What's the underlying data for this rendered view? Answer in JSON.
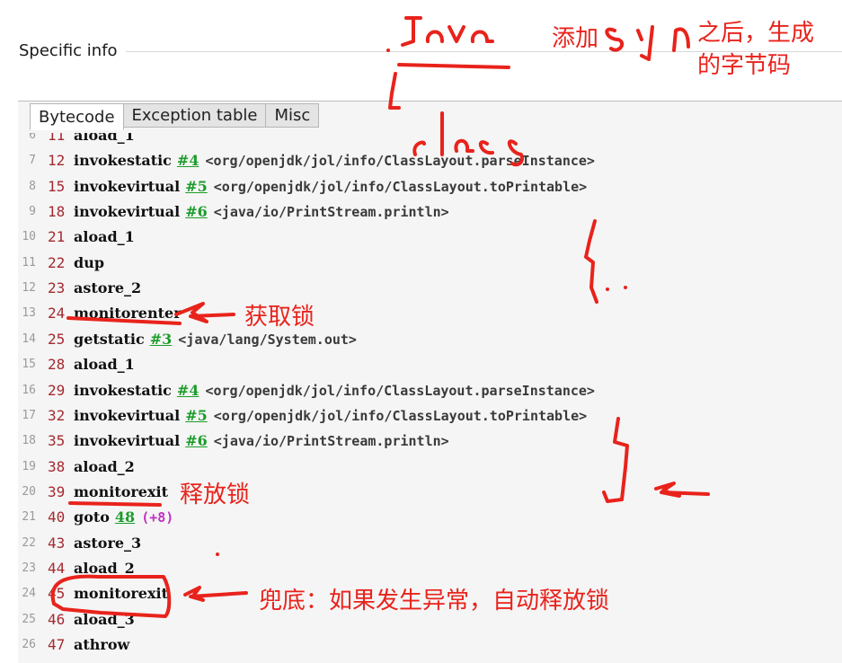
{
  "header": {
    "title": "Specific info"
  },
  "tabs": [
    {
      "label": "Bytecode",
      "active": true
    },
    {
      "label": "Exception table",
      "active": false
    },
    {
      "label": "Misc",
      "active": false
    }
  ],
  "bytecode": [
    {
      "line": "6",
      "offset": "11",
      "op": "aload_1"
    },
    {
      "line": "7",
      "offset": "12",
      "op": "invokestatic",
      "ref": "#4",
      "comment": "<org/openjdk/jol/info/ClassLayout.parseInstance>"
    },
    {
      "line": "8",
      "offset": "15",
      "op": "invokevirtual",
      "ref": "#5",
      "comment": "<org/openjdk/jol/info/ClassLayout.toPrintable>"
    },
    {
      "line": "9",
      "offset": "18",
      "op": "invokevirtual",
      "ref": "#6",
      "comment": "<java/io/PrintStream.println>"
    },
    {
      "line": "10",
      "offset": "21",
      "op": "aload_1"
    },
    {
      "line": "11",
      "offset": "22",
      "op": "dup"
    },
    {
      "line": "12",
      "offset": "23",
      "op": "astore_2"
    },
    {
      "line": "13",
      "offset": "24",
      "op": "monitorenter"
    },
    {
      "line": "14",
      "offset": "25",
      "op": "getstatic",
      "ref": "#3",
      "comment": "<java/lang/System.out>"
    },
    {
      "line": "15",
      "offset": "28",
      "op": "aload_1"
    },
    {
      "line": "16",
      "offset": "29",
      "op": "invokestatic",
      "ref": "#4",
      "comment": "<org/openjdk/jol/info/ClassLayout.parseInstance>"
    },
    {
      "line": "17",
      "offset": "32",
      "op": "invokevirtual",
      "ref": "#5",
      "comment": "<org/openjdk/jol/info/ClassLayout.toPrintable>"
    },
    {
      "line": "18",
      "offset": "35",
      "op": "invokevirtual",
      "ref": "#6",
      "comment": "<java/io/PrintStream.println>"
    },
    {
      "line": "19",
      "offset": "38",
      "op": "aload_2"
    },
    {
      "line": "20",
      "offset": "39",
      "op": "monitorexit"
    },
    {
      "line": "21",
      "offset": "40",
      "op": "goto",
      "ref": "48",
      "jump": "(+8)"
    },
    {
      "line": "22",
      "offset": "43",
      "op": "astore_3"
    },
    {
      "line": "23",
      "offset": "44",
      "op": "aload_2"
    },
    {
      "line": "24",
      "offset": "45",
      "op": "monitorexit"
    },
    {
      "line": "25",
      "offset": "46",
      "op": "aload_3"
    },
    {
      "line": "26",
      "offset": "47",
      "op": "athrow"
    }
  ],
  "annotations": {
    "top_note_a": "添加",
    "top_note_b": "之后，生成",
    "top_note_c": "的字节码",
    "acquire": "获取锁",
    "release": "释放锁",
    "fallback": "兜底：如果发生异常，自动释放锁"
  },
  "colors": {
    "annotation": "#e8231c",
    "offset": "#a4292f",
    "ref": "#1b9c2a",
    "jump": "#c030c0"
  }
}
